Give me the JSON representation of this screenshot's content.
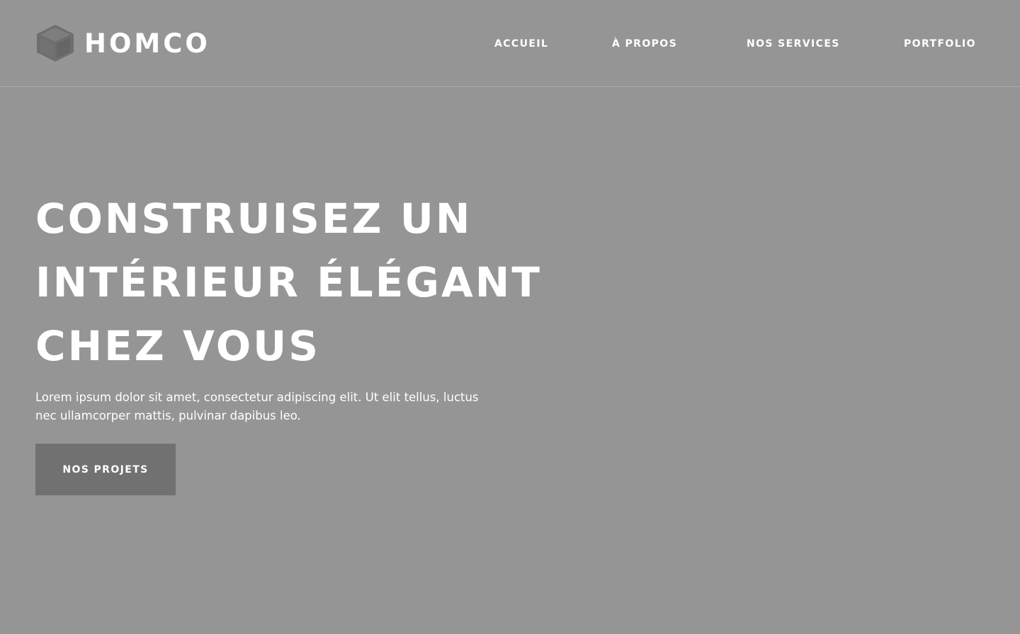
{
  "header": {
    "logo_text": "HOMCO",
    "nav": [
      {
        "label": "ACCUEIL"
      },
      {
        "label": "À PROPOS"
      },
      {
        "label": "NOS SERVICES"
      },
      {
        "label": "PORTFOLIO"
      }
    ]
  },
  "hero": {
    "title_lines": [
      "CONSTRUISEZ UN",
      "INTÉRIEUR ÉLÉGANT",
      "CHEZ VOUS"
    ],
    "description": "Lorem ipsum dolor sit amet, consectetur adipiscing elit. Ut elit tellus, luctus nec ullamcorper mattis, pulvinar dapibus leo.",
    "cta_label": "NOS PROJETS"
  },
  "icons": {
    "logo": "cube-icon"
  },
  "colors": {
    "background": "#959595",
    "button": "#717171",
    "logo_cube": "#6e6e6e",
    "text": "#ffffff"
  }
}
